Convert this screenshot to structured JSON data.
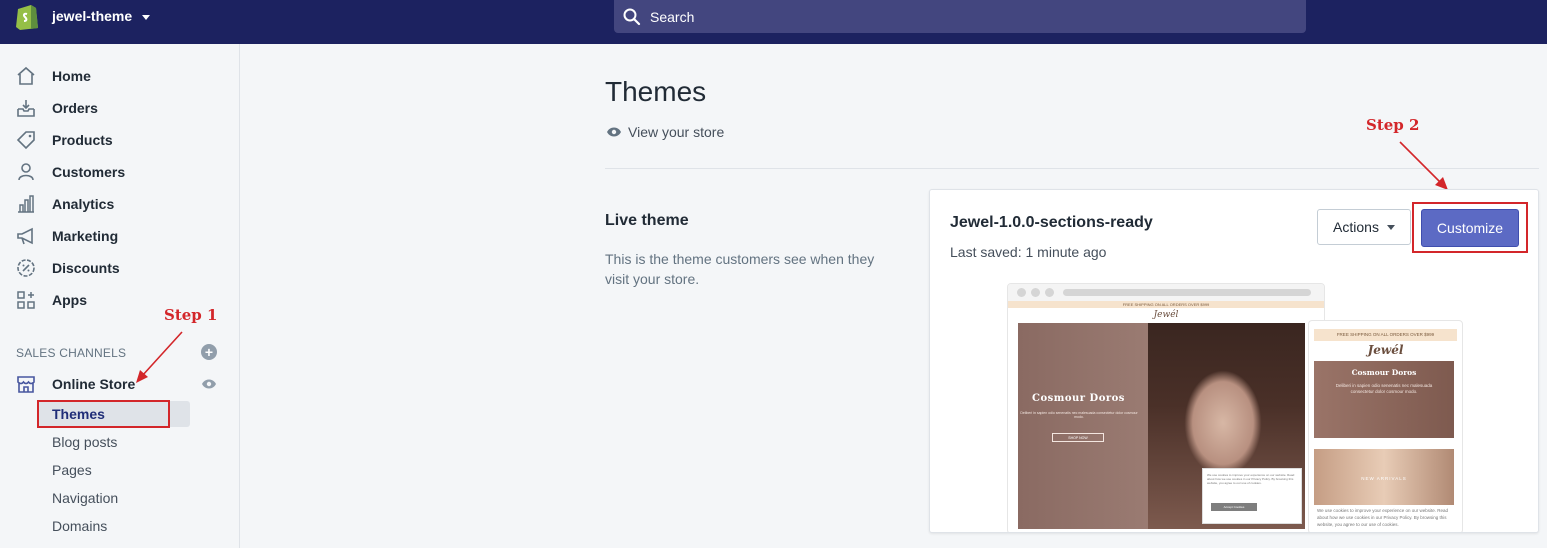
{
  "topbar": {
    "store_name": "jewel-theme",
    "search_placeholder": "Search",
    "bg_color": "#1c2260"
  },
  "sidebar": {
    "items": [
      {
        "label": "Home",
        "icon": "home-icon"
      },
      {
        "label": "Orders",
        "icon": "orders-icon"
      },
      {
        "label": "Products",
        "icon": "tag-icon"
      },
      {
        "label": "Customers",
        "icon": "person-icon"
      },
      {
        "label": "Analytics",
        "icon": "bar-chart-icon"
      },
      {
        "label": "Marketing",
        "icon": "megaphone-icon"
      },
      {
        "label": "Discounts",
        "icon": "discount-icon"
      },
      {
        "label": "Apps",
        "icon": "apps-icon"
      }
    ],
    "sales_channels_title": "SALES CHANNELS",
    "online_store_label": "Online Store",
    "sub_items": [
      "Themes",
      "Blog posts",
      "Pages",
      "Navigation",
      "Domains"
    ]
  },
  "annotations": {
    "step1": "Step 1",
    "step2": "Step 2",
    "color": "#d3262a"
  },
  "main": {
    "title": "Themes",
    "view_store": "View your store",
    "live_theme_title": "Live theme",
    "live_theme_desc": "This is the theme customers see when they visit your store.",
    "theme_name": "Jewel-1.0.0-sections-ready",
    "last_saved": "Last saved: 1 minute ago",
    "actions_label": "Actions",
    "customize_label": "Customize",
    "accent_color": "#5c6ac4"
  },
  "preview": {
    "promo_desktop": "FREE SHIPPING ON ALL ORDERS OVER $999",
    "logo": "Jewél",
    "hero_title": "Cosmour Doros",
    "hero_text": "Deliberi in sapien odio senenatis nec malesuada consectetur dolor cosmour modo.",
    "hero_button": "SHOP NOW",
    "cookie_text": "We use cookies to improve your experience on our website. Read about how we use cookies in our Privacy Policy. By browsing this website, you agree to our use of cookies.",
    "cookie_button": "Accept Cookies",
    "promo_mobile": "FREE SHIPPING ON ALL ORDERS OVER $999",
    "mobile_hero_text": "Deliberi in sapien odio senenatis nec malesuada consectetur dolor cosmour modo.",
    "new_arrivals": "NEW ARRIVALS"
  }
}
